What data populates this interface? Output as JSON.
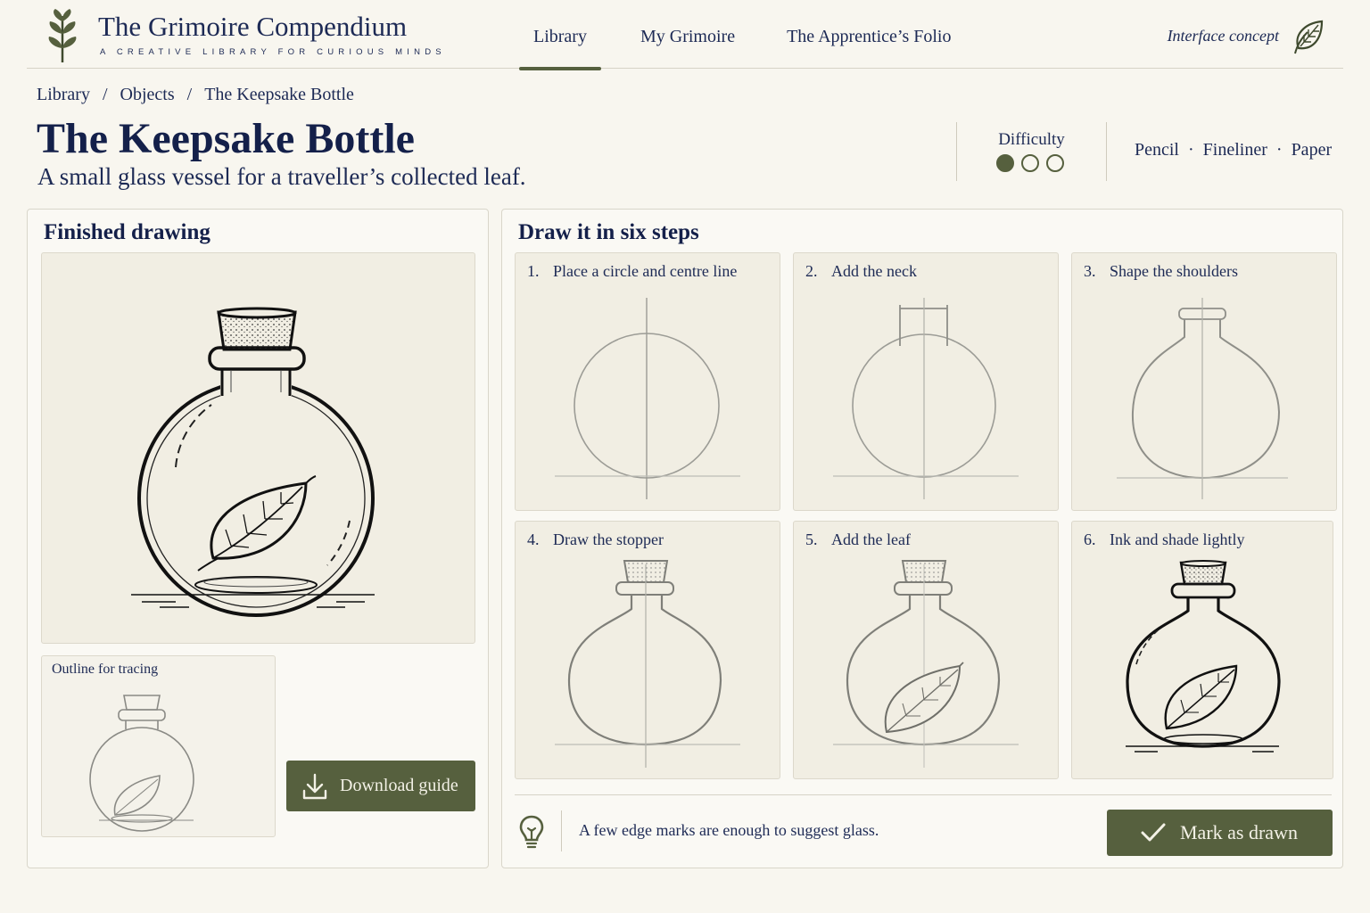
{
  "brand": {
    "title": "The Grimoire Compendium",
    "tagline": "A CREATIVE LIBRARY FOR CURIOUS MINDS",
    "logo_icon": "sprig-icon"
  },
  "nav": {
    "items": [
      {
        "label": "Library",
        "active": true
      },
      {
        "label": "My Grimoire",
        "active": false
      },
      {
        "label": "The Apprentice’s Folio",
        "active": false
      }
    ],
    "concept_label": "Interface concept",
    "concept_icon": "leaf-icon"
  },
  "breadcrumb": [
    "Library",
    "Objects",
    "The Keepsake Bottle"
  ],
  "breadcrumb_separator": "/",
  "page": {
    "title": "The Keepsake Bottle",
    "subtitle": "A small glass vessel for a traveller’s collected leaf."
  },
  "difficulty": {
    "label": "Difficulty",
    "level": 1,
    "max": 3
  },
  "materials": [
    "Pencil",
    "Fineliner",
    "Paper"
  ],
  "materials_separator": "·",
  "finished": {
    "heading": "Finished drawing",
    "outline_label": "Outline for tracing",
    "download_label": "Download guide",
    "download_icon": "download-icon"
  },
  "steps_panel": {
    "heading": "Draw it in six steps",
    "steps": [
      {
        "num": "1.",
        "text": "Place a circle and centre line"
      },
      {
        "num": "2.",
        "text": "Add the neck"
      },
      {
        "num": "3.",
        "text": "Shape the shoulders"
      },
      {
        "num": "4.",
        "text": "Draw the stopper"
      },
      {
        "num": "5.",
        "text": "Add the leaf"
      },
      {
        "num": "6.",
        "text": "Ink and shade lightly"
      }
    ],
    "tip_icon": "lightbulb-icon",
    "tip_text": "A few edge marks are enough to suggest glass.",
    "mark_label": "Mark as drawn",
    "mark_icon": "check-icon"
  },
  "colors": {
    "background": "#f8f6ef",
    "ink": "#1d2a55",
    "accent": "#56603e"
  }
}
